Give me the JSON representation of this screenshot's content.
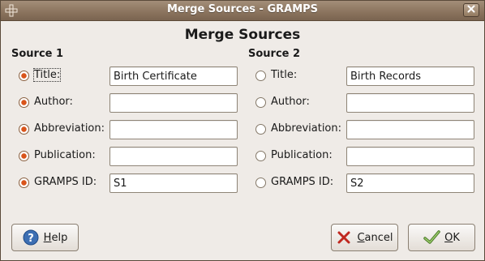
{
  "window": {
    "title": "Merge Sources - GRAMPS"
  },
  "dialog": {
    "heading": "Merge Sources"
  },
  "source1": {
    "header": "Source 1",
    "fields": [
      {
        "label": "Title:",
        "value": "Birth Certificate",
        "selected": true
      },
      {
        "label": "Author:",
        "value": "",
        "selected": true
      },
      {
        "label": "Abbreviation:",
        "value": "",
        "selected": true
      },
      {
        "label": "Publication:",
        "value": "",
        "selected": true
      },
      {
        "label": "GRAMPS ID:",
        "value": "S1",
        "selected": true
      }
    ]
  },
  "source2": {
    "header": "Source 2",
    "fields": [
      {
        "label": "Title:",
        "value": "Birth Records",
        "selected": false
      },
      {
        "label": "Author:",
        "value": "",
        "selected": false
      },
      {
        "label": "Abbreviation:",
        "value": "",
        "selected": false
      },
      {
        "label": "Publication:",
        "value": "",
        "selected": false
      },
      {
        "label": "GRAMPS ID:",
        "value": "S2",
        "selected": false
      }
    ]
  },
  "buttons": {
    "help": {
      "label": "Help",
      "mnemonic": "H",
      "rest": "elp",
      "icon": "help-icon"
    },
    "cancel": {
      "label": "Cancel",
      "mnemonic": "C",
      "rest": "ancel",
      "icon": "cancel-x-icon"
    },
    "ok": {
      "label": "OK",
      "mnemonic": "O",
      "rest": "K",
      "icon": "ok-check-icon"
    }
  },
  "colors": {
    "titlebar": "#8a735d",
    "radio_selected": "#d9541a",
    "background": "#efebe7"
  }
}
